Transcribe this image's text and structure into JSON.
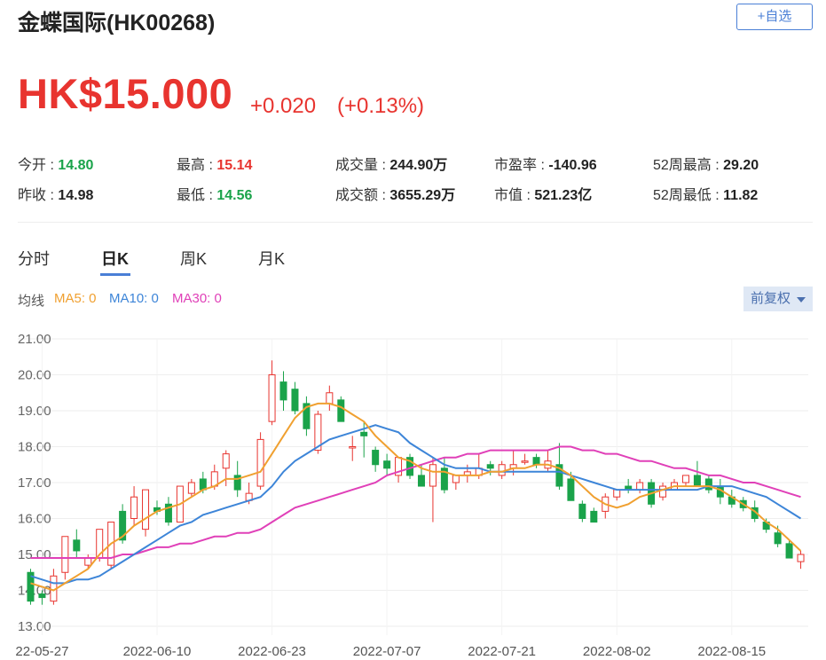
{
  "header": {
    "title": "金蝶国际(HK00268)",
    "add_button": "+自选"
  },
  "quote": {
    "price": "HK$15.000",
    "change": "+0.020",
    "change_pct": "(+0.13%)"
  },
  "stats": {
    "open_label": "今开 :",
    "open": "14.80",
    "prev_label": "昨收 :",
    "prev": "14.98",
    "high_label": "最高 :",
    "high": "15.14",
    "low_label": "最低 :",
    "low": "14.56",
    "vol_label": "成交量 :",
    "vol": "244.90万",
    "amt_label": "成交额 :",
    "amt": "3655.29万",
    "pe_label": "市盈率 :",
    "pe": "-140.96",
    "mcap_label": "市值 :",
    "mcap": "521.23亿",
    "w52h_label": "52周最高 :",
    "w52h": "29.20",
    "w52l_label": "52周最低 :",
    "w52l": "11.82"
  },
  "tabs": [
    "分时",
    "日K",
    "周K",
    "月K"
  ],
  "legend": {
    "label": "均线",
    "ma5": "MA5: 0",
    "ma10": "MA10: 0",
    "ma30": "MA30: 0"
  },
  "adjust": "前复权",
  "colors": {
    "up": "#e8342f",
    "down": "#1aa34a",
    "ma5": "#f0a030",
    "ma10": "#3d85d8",
    "ma30": "#e040b8"
  },
  "chart_data": {
    "type": "candlestick",
    "ylim": [
      13,
      21
    ],
    "yticks": [
      "21.00",
      "20.00",
      "19.00",
      "18.00",
      "17.00",
      "16.00",
      "15.00",
      "14.00",
      "13.00"
    ],
    "xticks": [
      "22-05-27",
      "2022-06-10",
      "2022-06-23",
      "2022-07-07",
      "2022-07-21",
      "2022-08-02",
      "2022-08-15"
    ],
    "xtick_index": [
      1,
      11,
      21,
      31,
      41,
      51,
      61
    ],
    "candles": [
      {
        "o": 14.5,
        "h": 14.6,
        "l": 13.6,
        "c": 13.7
      },
      {
        "o": 13.9,
        "h": 14.0,
        "l": 13.6,
        "c": 13.8
      },
      {
        "o": 13.7,
        "h": 14.6,
        "l": 13.6,
        "c": 14.4
      },
      {
        "o": 14.5,
        "h": 15.5,
        "l": 14.3,
        "c": 15.5
      },
      {
        "o": 15.4,
        "h": 15.7,
        "l": 14.9,
        "c": 15.1
      },
      {
        "o": 14.7,
        "h": 15.0,
        "l": 14.6,
        "c": 14.9
      },
      {
        "o": 14.9,
        "h": 15.7,
        "l": 14.8,
        "c": 15.7
      },
      {
        "o": 14.7,
        "h": 15.9,
        "l": 14.6,
        "c": 15.9
      },
      {
        "o": 16.2,
        "h": 16.4,
        "l": 15.3,
        "c": 15.4
      },
      {
        "o": 16.0,
        "h": 16.9,
        "l": 15.8,
        "c": 16.6
      },
      {
        "o": 15.7,
        "h": 16.8,
        "l": 15.5,
        "c": 16.8
      },
      {
        "o": 16.3,
        "h": 16.5,
        "l": 16.1,
        "c": 16.2
      },
      {
        "o": 16.4,
        "h": 16.6,
        "l": 15.8,
        "c": 15.9
      },
      {
        "o": 15.9,
        "h": 16.9,
        "l": 15.9,
        "c": 16.9
      },
      {
        "o": 16.7,
        "h": 17.1,
        "l": 16.6,
        "c": 17.0
      },
      {
        "o": 17.1,
        "h": 17.3,
        "l": 16.7,
        "c": 16.8
      },
      {
        "o": 16.9,
        "h": 17.5,
        "l": 16.8,
        "c": 17.3
      },
      {
        "o": 17.4,
        "h": 17.9,
        "l": 16.9,
        "c": 17.8
      },
      {
        "o": 17.2,
        "h": 17.6,
        "l": 16.6,
        "c": 16.8
      },
      {
        "o": 16.5,
        "h": 17.0,
        "l": 16.4,
        "c": 16.7
      },
      {
        "o": 16.9,
        "h": 18.4,
        "l": 16.8,
        "c": 18.2
      },
      {
        "o": 18.7,
        "h": 20.4,
        "l": 18.6,
        "c": 20.0
      },
      {
        "o": 19.8,
        "h": 20.1,
        "l": 19.0,
        "c": 19.3
      },
      {
        "o": 19.6,
        "h": 19.8,
        "l": 18.9,
        "c": 19.0
      },
      {
        "o": 19.2,
        "h": 19.4,
        "l": 18.3,
        "c": 18.5
      },
      {
        "o": 17.9,
        "h": 19.0,
        "l": 17.8,
        "c": 18.9
      },
      {
        "o": 19.2,
        "h": 19.7,
        "l": 19.0,
        "c": 19.5
      },
      {
        "o": 19.3,
        "h": 19.4,
        "l": 18.7,
        "c": 18.7
      },
      {
        "o": 18.0,
        "h": 18.3,
        "l": 17.6,
        "c": 18.0
      },
      {
        "o": 18.4,
        "h": 18.7,
        "l": 17.7,
        "c": 18.3
      },
      {
        "o": 17.9,
        "h": 18.0,
        "l": 17.3,
        "c": 17.5
      },
      {
        "o": 17.6,
        "h": 17.8,
        "l": 17.2,
        "c": 17.4
      },
      {
        "o": 17.2,
        "h": 17.7,
        "l": 17.0,
        "c": 17.7
      },
      {
        "o": 17.7,
        "h": 17.8,
        "l": 17.1,
        "c": 17.2
      },
      {
        "o": 17.2,
        "h": 17.5,
        "l": 16.9,
        "c": 16.9
      },
      {
        "o": 16.9,
        "h": 17.7,
        "l": 15.9,
        "c": 17.5
      },
      {
        "o": 17.4,
        "h": 17.7,
        "l": 16.7,
        "c": 16.8
      },
      {
        "o": 17.0,
        "h": 17.2,
        "l": 16.8,
        "c": 17.2
      },
      {
        "o": 17.2,
        "h": 17.5,
        "l": 17.0,
        "c": 17.3
      },
      {
        "o": 17.2,
        "h": 17.8,
        "l": 17.1,
        "c": 17.4
      },
      {
        "o": 17.5,
        "h": 17.6,
        "l": 17.2,
        "c": 17.4
      },
      {
        "o": 17.2,
        "h": 17.6,
        "l": 17.1,
        "c": 17.5
      },
      {
        "o": 17.4,
        "h": 17.9,
        "l": 17.2,
        "c": 17.5
      },
      {
        "o": 17.6,
        "h": 17.8,
        "l": 17.5,
        "c": 17.6
      },
      {
        "o": 17.7,
        "h": 17.8,
        "l": 17.4,
        "c": 17.5
      },
      {
        "o": 17.4,
        "h": 17.9,
        "l": 17.3,
        "c": 17.6
      },
      {
        "o": 17.5,
        "h": 18.1,
        "l": 16.8,
        "c": 16.9
      },
      {
        "o": 17.1,
        "h": 17.3,
        "l": 16.5,
        "c": 16.5
      },
      {
        "o": 16.4,
        "h": 16.5,
        "l": 15.9,
        "c": 16.0
      },
      {
        "o": 16.2,
        "h": 16.3,
        "l": 15.9,
        "c": 15.9
      },
      {
        "o": 16.2,
        "h": 16.7,
        "l": 16.0,
        "c": 16.6
      },
      {
        "o": 16.6,
        "h": 16.8,
        "l": 16.5,
        "c": 16.8
      },
      {
        "o": 16.9,
        "h": 17.1,
        "l": 16.7,
        "c": 16.8
      },
      {
        "o": 16.8,
        "h": 17.1,
        "l": 16.7,
        "c": 17.0
      },
      {
        "o": 17.0,
        "h": 17.1,
        "l": 16.3,
        "c": 16.4
      },
      {
        "o": 16.6,
        "h": 17.0,
        "l": 16.5,
        "c": 16.9
      },
      {
        "o": 16.8,
        "h": 17.1,
        "l": 16.8,
        "c": 17.0
      },
      {
        "o": 17.0,
        "h": 17.2,
        "l": 16.9,
        "c": 17.2
      },
      {
        "o": 17.2,
        "h": 17.6,
        "l": 16.9,
        "c": 16.9
      },
      {
        "o": 17.1,
        "h": 17.2,
        "l": 16.7,
        "c": 16.8
      },
      {
        "o": 16.9,
        "h": 17.1,
        "l": 16.4,
        "c": 16.6
      },
      {
        "o": 16.6,
        "h": 16.8,
        "l": 16.3,
        "c": 16.4
      },
      {
        "o": 16.5,
        "h": 16.6,
        "l": 16.2,
        "c": 16.3
      },
      {
        "o": 16.3,
        "h": 16.5,
        "l": 15.9,
        "c": 16.0
      },
      {
        "o": 15.9,
        "h": 16.0,
        "l": 15.6,
        "c": 15.7
      },
      {
        "o": 15.6,
        "h": 15.8,
        "l": 15.2,
        "c": 15.3
      },
      {
        "o": 15.3,
        "h": 15.4,
        "l": 14.9,
        "c": 14.9
      },
      {
        "o": 14.8,
        "h": 15.1,
        "l": 14.6,
        "c": 15.0
      }
    ],
    "ma5": [
      14.2,
      14.1,
      14.0,
      14.2,
      14.4,
      14.6,
      15.0,
      15.3,
      15.5,
      15.8,
      16.0,
      16.2,
      16.3,
      16.4,
      16.6,
      16.8,
      16.9,
      17.1,
      17.1,
      17.2,
      17.3,
      17.8,
      18.3,
      18.8,
      19.1,
      19.2,
      19.2,
      19.1,
      18.9,
      18.7,
      18.3,
      18.0,
      17.7,
      17.6,
      17.4,
      17.3,
      17.3,
      17.2,
      17.2,
      17.2,
      17.3,
      17.3,
      17.4,
      17.4,
      17.5,
      17.5,
      17.4,
      17.2,
      16.9,
      16.6,
      16.4,
      16.3,
      16.4,
      16.6,
      16.7,
      16.8,
      16.9,
      16.9,
      16.9,
      16.9,
      16.8,
      16.6,
      16.4,
      16.2,
      15.9,
      15.7,
      15.4,
      15.1
    ],
    "ma10": [
      14.4,
      14.3,
      14.2,
      14.2,
      14.3,
      14.3,
      14.4,
      14.6,
      14.8,
      15.0,
      15.2,
      15.4,
      15.6,
      15.8,
      15.9,
      16.1,
      16.2,
      16.3,
      16.4,
      16.5,
      16.6,
      16.9,
      17.3,
      17.6,
      17.8,
      18.0,
      18.2,
      18.3,
      18.4,
      18.5,
      18.6,
      18.5,
      18.4,
      18.1,
      17.9,
      17.7,
      17.5,
      17.4,
      17.4,
      17.4,
      17.3,
      17.3,
      17.3,
      17.3,
      17.3,
      17.3,
      17.3,
      17.2,
      17.1,
      17.0,
      16.9,
      16.8,
      16.8,
      16.8,
      16.8,
      16.8,
      16.8,
      16.8,
      16.8,
      16.9,
      16.9,
      16.9,
      16.8,
      16.7,
      16.6,
      16.4,
      16.2,
      16.0
    ],
    "ma30": [
      14.9,
      14.9,
      14.9,
      14.9,
      14.9,
      14.9,
      14.9,
      14.9,
      15.0,
      15.0,
      15.1,
      15.2,
      15.2,
      15.3,
      15.3,
      15.4,
      15.5,
      15.5,
      15.6,
      15.6,
      15.7,
      15.9,
      16.1,
      16.3,
      16.4,
      16.5,
      16.6,
      16.7,
      16.8,
      16.9,
      17.0,
      17.2,
      17.3,
      17.4,
      17.5,
      17.6,
      17.7,
      17.7,
      17.8,
      17.8,
      17.9,
      17.9,
      17.9,
      17.9,
      17.9,
      17.9,
      18.0,
      18.0,
      17.9,
      17.9,
      17.8,
      17.8,
      17.7,
      17.6,
      17.6,
      17.5,
      17.4,
      17.4,
      17.3,
      17.2,
      17.2,
      17.1,
      17.0,
      17.0,
      16.9,
      16.8,
      16.7,
      16.6
    ]
  }
}
